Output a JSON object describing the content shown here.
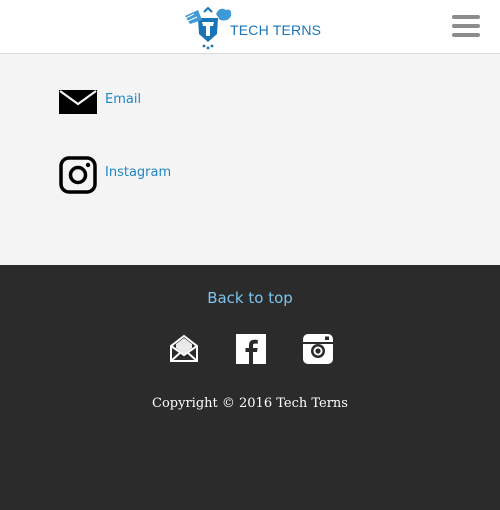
{
  "header": {
    "logo_text": "TECH TERNS",
    "logo_icon": "tech-terns-logo",
    "menu_icon": "hamburger-menu-icon"
  },
  "contact": {
    "items": [
      {
        "label": "Email",
        "icon": "envelope-icon"
      },
      {
        "label": "Instagram",
        "icon": "instagram-icon"
      }
    ]
  },
  "footer": {
    "back_to_top": "Back to top",
    "social_icons": [
      "open-envelope-icon",
      "facebook-icon",
      "instagram-camera-icon"
    ],
    "copyright": "Copyright © 2016 Tech Terns"
  },
  "colors": {
    "brand_blue": "#1a74b8",
    "link_blue": "#1f86c4",
    "footer_link": "#7ec3ec",
    "footer_bg": "#2b2b2b",
    "content_bg": "#f4f4f4"
  }
}
